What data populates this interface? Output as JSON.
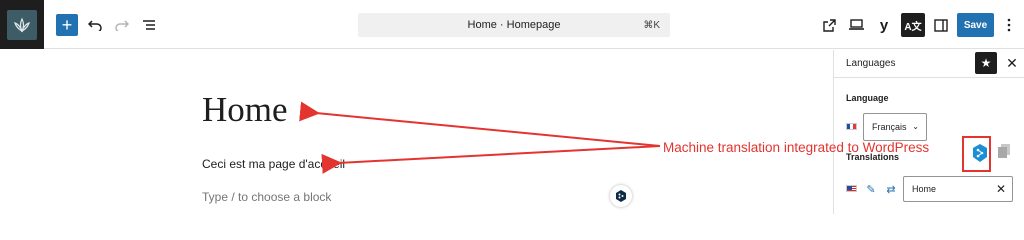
{
  "toolbar": {
    "command_center_title": "Home · Homepage",
    "command_center_shortcut": "⌘K",
    "save_label": "Save",
    "yoast_label": "y",
    "translate_label": "A文"
  },
  "canvas": {
    "title": "Home",
    "paragraph": "Ceci est ma page d'accueil",
    "block_hint": "Type / to choose a block"
  },
  "sidebar": {
    "title": "Languages",
    "language_label": "Language",
    "language_selected": "Français",
    "translations_label": "Translations",
    "translation_value": "Home"
  },
  "annotation": {
    "text": "Machine translation integrated to WordPress",
    "color": "#e3342f"
  },
  "colors": {
    "accent": "#2271b1",
    "dark": "#1e1e1e"
  }
}
